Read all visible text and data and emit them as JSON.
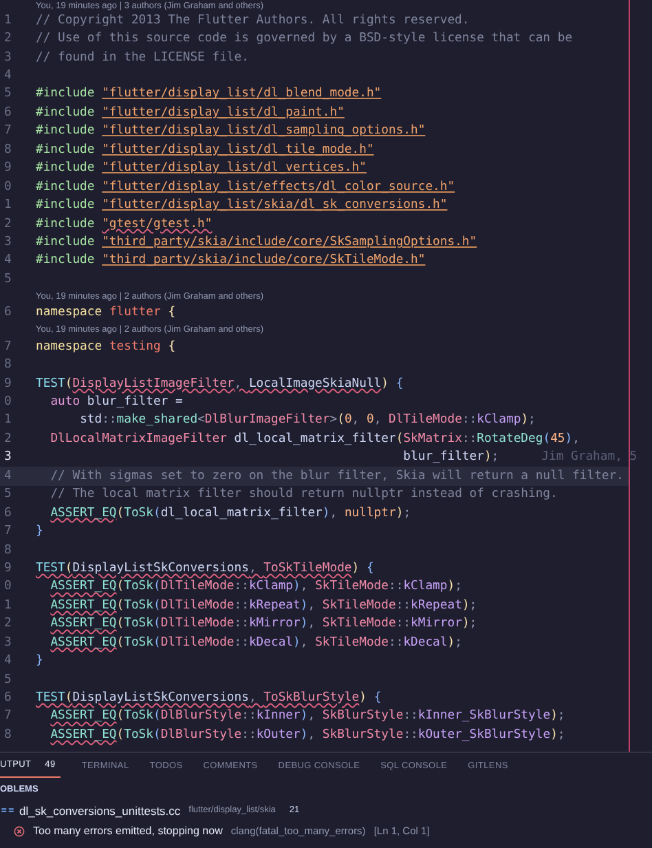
{
  "editor": {
    "top_lens": "You, 19 minutes ago | 3 authors (Jim Graham and others)",
    "lines": [
      {
        "kind": "code",
        "number": "1",
        "current": false,
        "highlighted": false,
        "segments": [
          {
            "squiggle": false,
            "tokens": [
              {
                "kind": "comment",
                "text": "// Copyright 2013 The Flutter Authors. All rights reserved."
              }
            ]
          }
        ]
      },
      {
        "kind": "code",
        "number": "2",
        "current": false,
        "highlighted": false,
        "segments": [
          {
            "squiggle": false,
            "tokens": [
              {
                "kind": "comment",
                "text": "// Use of this source code is governed by a BSD-style license that can be"
              }
            ]
          }
        ]
      },
      {
        "kind": "code",
        "number": "3",
        "current": false,
        "highlighted": false,
        "segments": [
          {
            "squiggle": false,
            "tokens": [
              {
                "kind": "comment",
                "text": "// found in the LICENSE file."
              }
            ]
          }
        ]
      },
      {
        "kind": "code",
        "number": "4",
        "current": false,
        "highlighted": false
      },
      {
        "kind": "code",
        "number": "5",
        "current": false,
        "highlighted": false,
        "segments": [
          {
            "squiggle": false,
            "tokens": [
              {
                "kind": "directive",
                "text": "#include "
              },
              {
                "kind": "string",
                "text": "\"flutter/display_list/dl_blend_mode.h\""
              }
            ]
          }
        ]
      },
      {
        "kind": "code",
        "number": "6",
        "current": false,
        "highlighted": false,
        "segments": [
          {
            "squiggle": false,
            "tokens": [
              {
                "kind": "directive",
                "text": "#include "
              },
              {
                "kind": "string",
                "text": "\"flutter/display_list/dl_paint.h\""
              }
            ]
          }
        ]
      },
      {
        "kind": "code",
        "number": "7",
        "current": false,
        "highlighted": false,
        "segments": [
          {
            "squiggle": false,
            "tokens": [
              {
                "kind": "directive",
                "text": "#include "
              },
              {
                "kind": "string",
                "text": "\"flutter/display_list/dl_sampling_options.h\""
              }
            ]
          }
        ]
      },
      {
        "kind": "code",
        "number": "8",
        "current": false,
        "highlighted": false,
        "segments": [
          {
            "squiggle": false,
            "tokens": [
              {
                "kind": "directive",
                "text": "#include "
              },
              {
                "kind": "string",
                "text": "\"flutter/display_list/dl_tile_mode.h\""
              }
            ]
          }
        ]
      },
      {
        "kind": "code",
        "number": "9",
        "current": false,
        "highlighted": false,
        "segments": [
          {
            "squiggle": false,
            "tokens": [
              {
                "kind": "directive",
                "text": "#include "
              },
              {
                "kind": "string",
                "text": "\"flutter/display_list/dl_vertices.h\""
              }
            ]
          }
        ]
      },
      {
        "kind": "code",
        "number": "0",
        "current": false,
        "highlighted": false,
        "segments": [
          {
            "squiggle": false,
            "tokens": [
              {
                "kind": "directive",
                "text": "#include "
              },
              {
                "kind": "string",
                "text": "\"flutter/display_list/effects/dl_color_source.h\""
              }
            ]
          }
        ]
      },
      {
        "kind": "code",
        "number": "1",
        "current": false,
        "highlighted": false,
        "segments": [
          {
            "squiggle": false,
            "tokens": [
              {
                "kind": "directive",
                "text": "#include "
              },
              {
                "kind": "string",
                "text": "\"flutter/display_list/skia/dl_sk_conversions.h\""
              }
            ]
          }
        ]
      },
      {
        "kind": "code",
        "number": "2",
        "current": false,
        "highlighted": false,
        "segments": [
          {
            "squiggle": false,
            "tokens": [
              {
                "kind": "directive",
                "text": "#include "
              }
            ]
          },
          {
            "squiggle": true,
            "tokens": [
              {
                "kind": "string",
                "text": "\"gtest/gtest.h\""
              }
            ]
          }
        ]
      },
      {
        "kind": "code",
        "number": "3",
        "current": false,
        "highlighted": false,
        "segments": [
          {
            "squiggle": false,
            "tokens": [
              {
                "kind": "directive",
                "text": "#include "
              },
              {
                "kind": "string",
                "text": "\"third_party/skia/include/core/SkSamplingOptions.h\""
              }
            ]
          }
        ]
      },
      {
        "kind": "code",
        "number": "4",
        "current": false,
        "highlighted": false,
        "segments": [
          {
            "squiggle": false,
            "tokens": [
              {
                "kind": "directive",
                "text": "#include "
              },
              {
                "kind": "string",
                "text": "\"third_party/skia/include/core/SkTileMode.h\""
              }
            ]
          }
        ]
      },
      {
        "kind": "code",
        "number": "5",
        "current": false,
        "highlighted": false
      },
      {
        "kind": "lens",
        "text": "You, 19 minutes ago | 2 authors (Jim Graham and others)"
      },
      {
        "kind": "code",
        "number": "6",
        "current": false,
        "highlighted": false,
        "segments": [
          {
            "squiggle": false,
            "tokens": [
              {
                "kind": "storage",
                "text": "namespace "
              },
              {
                "kind": "name",
                "text": "flutter "
              },
              {
                "kind": "paren",
                "text": "{"
              }
            ]
          }
        ]
      },
      {
        "kind": "lens",
        "text": "You, 19 minutes ago | 2 authors (Jim Graham and others)"
      },
      {
        "kind": "code",
        "number": "7",
        "current": false,
        "highlighted": false,
        "segments": [
          {
            "squiggle": false,
            "tokens": [
              {
                "kind": "storage",
                "text": "namespace "
              },
              {
                "kind": "name",
                "text": "testing "
              },
              {
                "kind": "paren",
                "text": "{"
              }
            ]
          }
        ]
      },
      {
        "kind": "code",
        "number": "8",
        "current": false,
        "highlighted": false
      },
      {
        "kind": "code",
        "number": "9",
        "current": false,
        "highlighted": false,
        "segments": [
          {
            "squiggle": false,
            "tokens": [
              {
                "kind": "macro",
                "text": "TEST"
              },
              {
                "kind": "paren",
                "text": "("
              }
            ]
          },
          {
            "squiggle": true,
            "tokens": [
              {
                "kind": "type",
                "text": "DisplayListImageFilter"
              },
              {
                "kind": "punct",
                "text": ", "
              },
              {
                "kind": "plain",
                "text": "LocalImageSkiaNull"
              }
            ]
          },
          {
            "squiggle": false,
            "tokens": [
              {
                "kind": "paren",
                "text": ")"
              },
              {
                "kind": "brace",
                "text": " {"
              }
            ]
          }
        ]
      },
      {
        "kind": "code",
        "number": "0",
        "current": false,
        "highlighted": false,
        "segments": [
          {
            "squiggle": false,
            "tokens": [
              {
                "kind": "keyword",
                "text": "  auto"
              },
              {
                "kind": "plain",
                "text": " blur_filter ="
              }
            ]
          }
        ]
      },
      {
        "kind": "code",
        "number": "1",
        "current": false,
        "highlighted": false,
        "segments": [
          {
            "squiggle": false,
            "tokens": [
              {
                "kind": "plain",
                "text": "      std"
              },
              {
                "kind": "punct",
                "text": "::"
              },
              {
                "kind": "func",
                "text": "make_shared"
              },
              {
                "kind": "punct",
                "text": "<"
              },
              {
                "kind": "type",
                "text": "DlBlurImageFilter"
              },
              {
                "kind": "punct",
                "text": ">"
              },
              {
                "kind": "paren",
                "text": "("
              },
              {
                "kind": "number",
                "text": "0"
              },
              {
                "kind": "punct",
                "text": ", "
              },
              {
                "kind": "number",
                "text": "0"
              },
              {
                "kind": "punct",
                "text": ", "
              },
              {
                "kind": "type",
                "text": "DlTileMode"
              },
              {
                "kind": "punct",
                "text": "::"
              },
              {
                "kind": "member",
                "text": "kClamp"
              },
              {
                "kind": "paren",
                "text": ")"
              },
              {
                "kind": "punct",
                "text": ";"
              }
            ]
          }
        ]
      },
      {
        "kind": "code",
        "number": "2",
        "current": false,
        "highlighted": false,
        "segments": [
          {
            "squiggle": false,
            "tokens": [
              {
                "kind": "type",
                "text": "  DlLocalMatrixImageFilter"
              },
              {
                "kind": "plain",
                "text": " dl_local_matrix_filter"
              },
              {
                "kind": "paren",
                "text": "("
              },
              {
                "kind": "type",
                "text": "SkMatrix"
              },
              {
                "kind": "punct",
                "text": "::"
              },
              {
                "kind": "func",
                "text": "RotateDeg"
              },
              {
                "kind": "brace",
                "text": "("
              },
              {
                "kind": "number",
                "text": "45"
              },
              {
                "kind": "brace",
                "text": ")"
              },
              {
                "kind": "punct",
                "text": ","
              }
            ]
          }
        ]
      },
      {
        "kind": "code",
        "number": "3",
        "current": true,
        "highlighted": false,
        "blame": "Jim Graham, 5",
        "segments": [
          {
            "squiggle": false,
            "tokens": [
              {
                "kind": "plain",
                "text": "                                                  blur_filter"
              },
              {
                "kind": "paren",
                "text": ")"
              },
              {
                "kind": "punct",
                "text": ";"
              }
            ]
          }
        ]
      },
      {
        "kind": "code",
        "number": "4",
        "current": false,
        "highlighted": true,
        "segments": [
          {
            "squiggle": false,
            "tokens": [
              {
                "kind": "comment",
                "text": "  // With sigmas set to zero on the blur filter, Skia will return a null filter."
              }
            ]
          }
        ]
      },
      {
        "kind": "code",
        "number": "5",
        "current": false,
        "highlighted": false,
        "segments": [
          {
            "squiggle": false,
            "tokens": [
              {
                "kind": "comment",
                "text": "  // The local matrix filter should return nullptr instead of crashing."
              }
            ]
          }
        ]
      },
      {
        "kind": "code",
        "number": "6",
        "current": false,
        "highlighted": false,
        "segments": [
          {
            "squiggle": true,
            "tokens": [
              {
                "kind": "func",
                "text": "  ASSERT_EQ"
              }
            ]
          },
          {
            "squiggle": false,
            "tokens": [
              {
                "kind": "paren",
                "text": "("
              },
              {
                "kind": "func",
                "text": "ToSk"
              },
              {
                "kind": "brace",
                "text": "("
              },
              {
                "kind": "plain",
                "text": "dl_local_matrix_filter"
              },
              {
                "kind": "brace",
                "text": ")"
              },
              {
                "kind": "punct",
                "text": ", "
              },
              {
                "kind": "number",
                "text": "nullptr"
              },
              {
                "kind": "paren",
                "text": ")"
              },
              {
                "kind": "punct",
                "text": ";"
              }
            ]
          }
        ]
      },
      {
        "kind": "code",
        "number": "7",
        "current": false,
        "highlighted": false,
        "segments": [
          {
            "squiggle": false,
            "tokens": [
              {
                "kind": "brace",
                "text": "}"
              }
            ]
          }
        ]
      },
      {
        "kind": "code",
        "number": "8",
        "current": false,
        "highlighted": false
      },
      {
        "kind": "code",
        "number": "9",
        "current": false,
        "highlighted": false,
        "segments": [
          {
            "squiggle": true,
            "tokens": [
              {
                "kind": "macro",
                "text": "TEST"
              },
              {
                "kind": "paren",
                "text": "("
              },
              {
                "kind": "plain",
                "text": "DisplayListSkConversions"
              },
              {
                "kind": "punct",
                "text": ", "
              },
              {
                "kind": "type",
                "text": "ToSkTileMode"
              }
            ]
          },
          {
            "squiggle": false,
            "tokens": [
              {
                "kind": "paren",
                "text": ")"
              },
              {
                "kind": "brace",
                "text": " {"
              }
            ]
          }
        ]
      },
      {
        "kind": "code",
        "number": "0",
        "current": false,
        "highlighted": false,
        "segments": [
          {
            "squiggle": true,
            "tokens": [
              {
                "kind": "func",
                "text": "  ASSERT_EQ"
              }
            ]
          },
          {
            "squiggle": false,
            "tokens": [
              {
                "kind": "paren",
                "text": "("
              },
              {
                "kind": "func",
                "text": "ToSk"
              },
              {
                "kind": "brace",
                "text": "("
              },
              {
                "kind": "type",
                "text": "DlTileMode"
              },
              {
                "kind": "punct",
                "text": "::"
              },
              {
                "kind": "member",
                "text": "kClamp"
              },
              {
                "kind": "brace",
                "text": ")"
              },
              {
                "kind": "punct",
                "text": ", "
              },
              {
                "kind": "type",
                "text": "SkTileMode"
              },
              {
                "kind": "punct",
                "text": "::"
              },
              {
                "kind": "member",
                "text": "kClamp"
              },
              {
                "kind": "paren",
                "text": ")"
              },
              {
                "kind": "punct",
                "text": ";"
              }
            ]
          }
        ]
      },
      {
        "kind": "code",
        "number": "1",
        "current": false,
        "highlighted": false,
        "segments": [
          {
            "squiggle": true,
            "tokens": [
              {
                "kind": "func",
                "text": "  ASSERT_EQ"
              }
            ]
          },
          {
            "squiggle": false,
            "tokens": [
              {
                "kind": "paren",
                "text": "("
              },
              {
                "kind": "func",
                "text": "ToSk"
              },
              {
                "kind": "brace",
                "text": "("
              },
              {
                "kind": "type",
                "text": "DlTileMode"
              },
              {
                "kind": "punct",
                "text": "::"
              },
              {
                "kind": "member",
                "text": "kRepeat"
              },
              {
                "kind": "brace",
                "text": ")"
              },
              {
                "kind": "punct",
                "text": ", "
              },
              {
                "kind": "type",
                "text": "SkTileMode"
              },
              {
                "kind": "punct",
                "text": "::"
              },
              {
                "kind": "member",
                "text": "kRepeat"
              },
              {
                "kind": "paren",
                "text": ")"
              },
              {
                "kind": "punct",
                "text": ";"
              }
            ]
          }
        ]
      },
      {
        "kind": "code",
        "number": "2",
        "current": false,
        "highlighted": false,
        "segments": [
          {
            "squiggle": true,
            "tokens": [
              {
                "kind": "func",
                "text": "  ASSERT_EQ"
              }
            ]
          },
          {
            "squiggle": false,
            "tokens": [
              {
                "kind": "paren",
                "text": "("
              },
              {
                "kind": "func",
                "text": "ToSk"
              },
              {
                "kind": "brace",
                "text": "("
              },
              {
                "kind": "type",
                "text": "DlTileMode"
              },
              {
                "kind": "punct",
                "text": "::"
              },
              {
                "kind": "member",
                "text": "kMirror"
              },
              {
                "kind": "brace",
                "text": ")"
              },
              {
                "kind": "punct",
                "text": ", "
              },
              {
                "kind": "type",
                "text": "SkTileMode"
              },
              {
                "kind": "punct",
                "text": "::"
              },
              {
                "kind": "member",
                "text": "kMirror"
              },
              {
                "kind": "paren",
                "text": ")"
              },
              {
                "kind": "punct",
                "text": ";"
              }
            ]
          }
        ]
      },
      {
        "kind": "code",
        "number": "3",
        "current": false,
        "highlighted": false,
        "segments": [
          {
            "squiggle": true,
            "tokens": [
              {
                "kind": "func",
                "text": "  ASSERT_EQ"
              }
            ]
          },
          {
            "squiggle": false,
            "tokens": [
              {
                "kind": "paren",
                "text": "("
              },
              {
                "kind": "func",
                "text": "ToSk"
              },
              {
                "kind": "brace",
                "text": "("
              },
              {
                "kind": "type",
                "text": "DlTileMode"
              },
              {
                "kind": "punct",
                "text": "::"
              },
              {
                "kind": "member",
                "text": "kDecal"
              },
              {
                "kind": "brace",
                "text": ")"
              },
              {
                "kind": "punct",
                "text": ", "
              },
              {
                "kind": "type",
                "text": "SkTileMode"
              },
              {
                "kind": "punct",
                "text": "::"
              },
              {
                "kind": "member",
                "text": "kDecal"
              },
              {
                "kind": "paren",
                "text": ")"
              },
              {
                "kind": "punct",
                "text": ";"
              }
            ]
          }
        ]
      },
      {
        "kind": "code",
        "number": "4",
        "current": false,
        "highlighted": false,
        "segments": [
          {
            "squiggle": false,
            "tokens": [
              {
                "kind": "brace",
                "text": "}"
              }
            ]
          }
        ]
      },
      {
        "kind": "code",
        "number": "5",
        "current": false,
        "highlighted": false
      },
      {
        "kind": "code",
        "number": "6",
        "current": false,
        "highlighted": false,
        "segments": [
          {
            "squiggle": true,
            "tokens": [
              {
                "kind": "macro",
                "text": "TEST"
              },
              {
                "kind": "paren",
                "text": "("
              },
              {
                "kind": "plain",
                "text": "DisplayListSkConversions"
              },
              {
                "kind": "punct",
                "text": ", "
              },
              {
                "kind": "type",
                "text": "ToSkBlurStyle"
              }
            ]
          },
          {
            "squiggle": false,
            "tokens": [
              {
                "kind": "paren",
                "text": ")"
              },
              {
                "kind": "brace",
                "text": " {"
              }
            ]
          }
        ]
      },
      {
        "kind": "code",
        "number": "7",
        "current": false,
        "highlighted": false,
        "segments": [
          {
            "squiggle": true,
            "tokens": [
              {
                "kind": "func",
                "text": "  ASSERT_EQ"
              }
            ]
          },
          {
            "squiggle": false,
            "tokens": [
              {
                "kind": "paren",
                "text": "("
              },
              {
                "kind": "func",
                "text": "ToSk"
              },
              {
                "kind": "brace",
                "text": "("
              },
              {
                "kind": "type",
                "text": "DlBlurStyle"
              },
              {
                "kind": "punct",
                "text": "::"
              },
              {
                "kind": "member",
                "text": "kInner"
              },
              {
                "kind": "brace",
                "text": ")"
              },
              {
                "kind": "punct",
                "text": ", "
              },
              {
                "kind": "type",
                "text": "SkBlurStyle"
              },
              {
                "kind": "punct",
                "text": "::"
              },
              {
                "kind": "member",
                "text": "kInner_SkBlurStyle"
              },
              {
                "kind": "paren",
                "text": ")"
              },
              {
                "kind": "punct",
                "text": ";"
              }
            ]
          }
        ]
      },
      {
        "kind": "code",
        "number": "8",
        "current": false,
        "highlighted": false,
        "segments": [
          {
            "squiggle": true,
            "tokens": [
              {
                "kind": "func",
                "text": "  ASSERT_EQ"
              }
            ]
          },
          {
            "squiggle": false,
            "tokens": [
              {
                "kind": "paren",
                "text": "("
              },
              {
                "kind": "func",
                "text": "ToSk"
              },
              {
                "kind": "brace",
                "text": "("
              },
              {
                "kind": "type",
                "text": "DlBlurStyle"
              },
              {
                "kind": "punct",
                "text": "::"
              },
              {
                "kind": "member",
                "text": "kOuter"
              },
              {
                "kind": "brace",
                "text": ")"
              },
              {
                "kind": "punct",
                "text": ", "
              },
              {
                "kind": "type",
                "text": "SkBlurStyle"
              },
              {
                "kind": "punct",
                "text": "::"
              },
              {
                "kind": "member",
                "text": "kOuter_SkBlurStyle"
              },
              {
                "kind": "paren",
                "text": ")"
              },
              {
                "kind": "punct",
                "text": ";"
              }
            ]
          }
        ]
      }
    ]
  },
  "panel": {
    "tabs": [
      {
        "label": "UTPUT",
        "badge": "49",
        "selected": true
      },
      {
        "label": "TERMINAL",
        "selected": false
      },
      {
        "label": "TODOS",
        "selected": false
      },
      {
        "label": "COMMENTS",
        "selected": false
      },
      {
        "label": "DEBUG CONSOLE",
        "selected": false
      },
      {
        "label": "SQL CONSOLE",
        "selected": false
      },
      {
        "label": "GITLENS",
        "selected": false
      }
    ],
    "section_title": "OBLEMS",
    "file": {
      "name": "dl_sk_conversions_unittests.cc",
      "path": "flutter/display_list/skia",
      "count": "21"
    },
    "problems": [
      {
        "kind": "error",
        "message": "Too many errors emitted, stopping now",
        "source": "clang(fatal_too_many_errors)",
        "location": "[Ln 1, Col 1]"
      }
    ]
  }
}
